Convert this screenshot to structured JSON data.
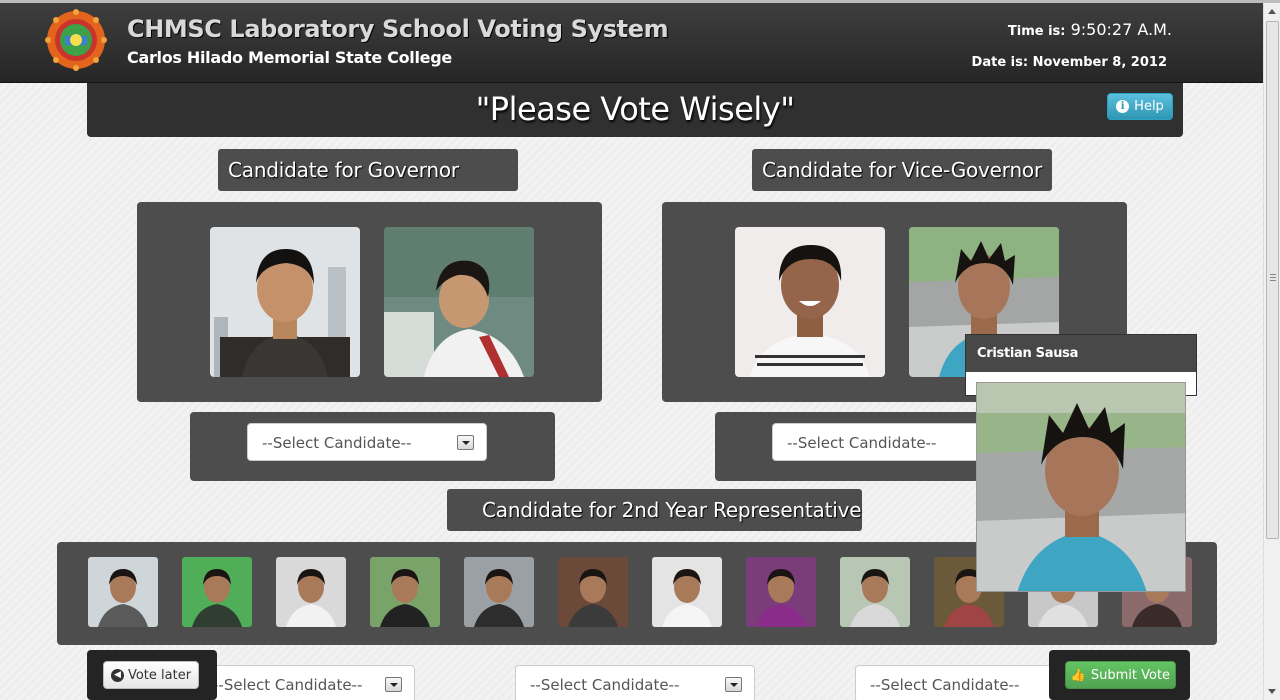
{
  "header": {
    "title": "CHMSC Laboratory School Voting System",
    "subtitle": "Carlos Hilado Memorial State College",
    "time_label": "Time is:",
    "time_value": "9:50:27 A.M.",
    "date_label": "Date is:",
    "date_value": "November 8, 2012",
    "logo_icon": "college-seal-logo"
  },
  "banner": {
    "text": "\"Please Vote Wisely\"",
    "help_label": "Help",
    "help_icon": "info-icon"
  },
  "governor": {
    "label": "Candidate for Governor",
    "select_value": "--Select Candidate--",
    "candidates": 2
  },
  "vice_governor": {
    "label": "Candidate for Vice-Governor",
    "select_value": "--Select Candidate--",
    "candidates": 2
  },
  "representative": {
    "label": "Candidate for 2nd Year Representative",
    "candidates": 12,
    "selects": [
      "--Select Candidate--",
      "--Select Candidate--",
      "--Select Candidate--"
    ]
  },
  "tooltip": {
    "name": "Cristian Sausa"
  },
  "actions": {
    "vote_later_label": "Vote later",
    "vote_later_icon": "back-arrow-icon",
    "submit_label": "Submit Vote",
    "submit_icon": "thumbs-up-icon"
  },
  "colors": {
    "header_bg": "#2b2b2b",
    "panel_bg": "#4d4d4d",
    "help_blue": "#2f96b4",
    "submit_green": "#51a351"
  }
}
